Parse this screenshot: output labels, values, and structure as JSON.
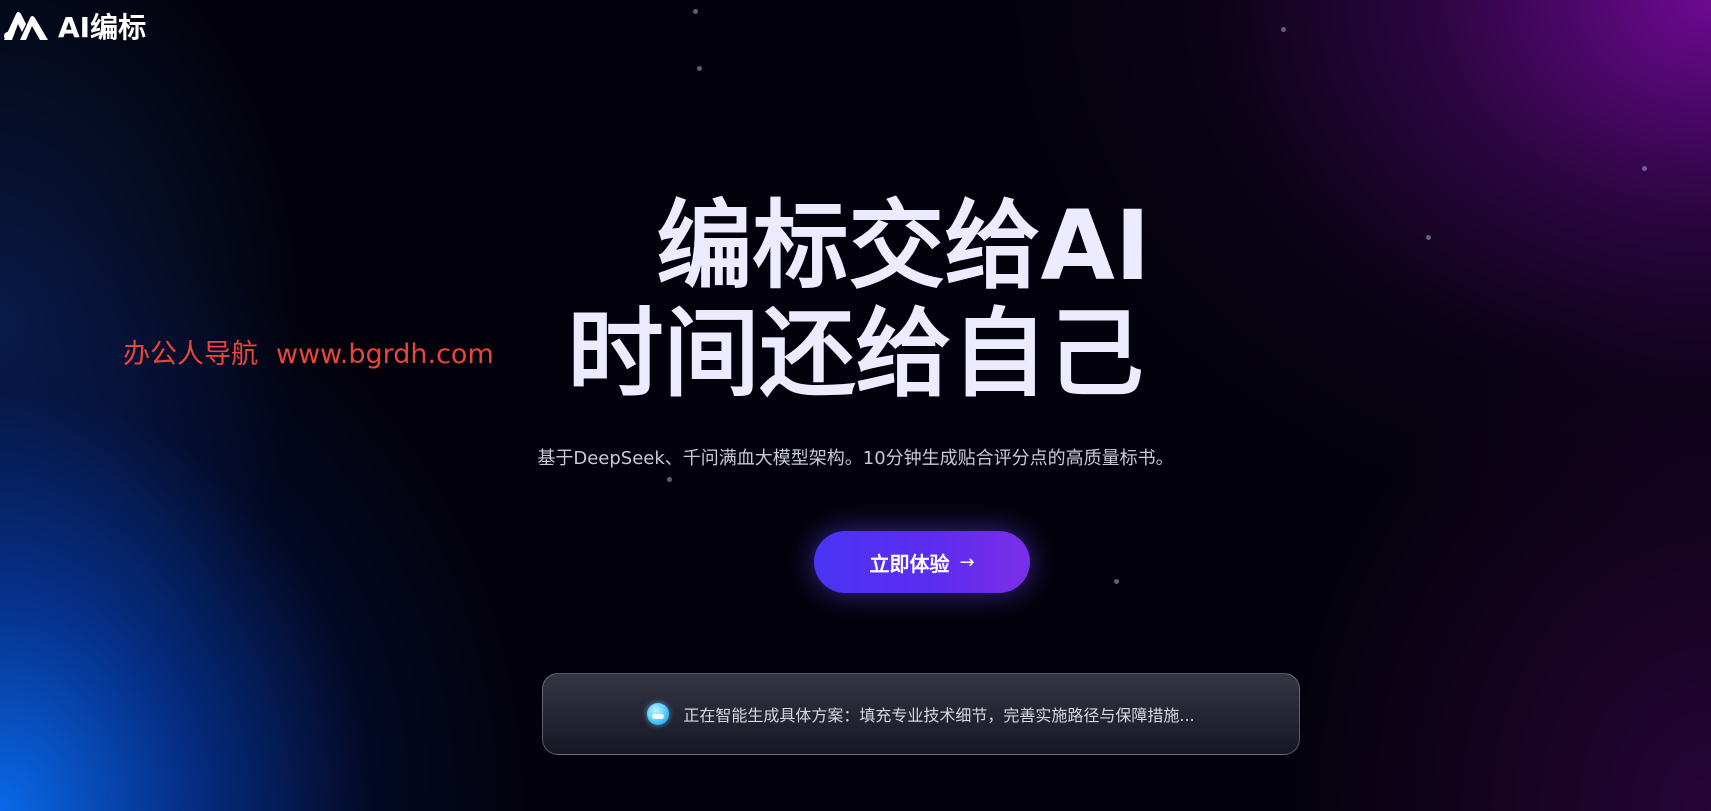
{
  "header": {
    "logo_text": "AI编标",
    "logo_icon": "ai-logo-icon"
  },
  "watermark": {
    "name": "办公人导航",
    "url": "www.bgrdh.com"
  },
  "hero": {
    "title_line1": "编标交给AI",
    "title_line2": "时间还给自己",
    "subtitle": "基于DeepSeek、千问满血大模型架构。10分钟生成贴合评分点的高质量标书。"
  },
  "cta": {
    "label": "立即体验",
    "arrow": "→"
  },
  "status": {
    "icon": "ai-status-icon",
    "text": "正在智能生成具体方案：填充专业技术细节，完善实施路径与保障措施..."
  },
  "colors": {
    "background": "#03020c",
    "accent": "#4a34f5",
    "accent_end": "#7b2ee8",
    "watermark": "#e8453b",
    "title": "#ecebff"
  }
}
